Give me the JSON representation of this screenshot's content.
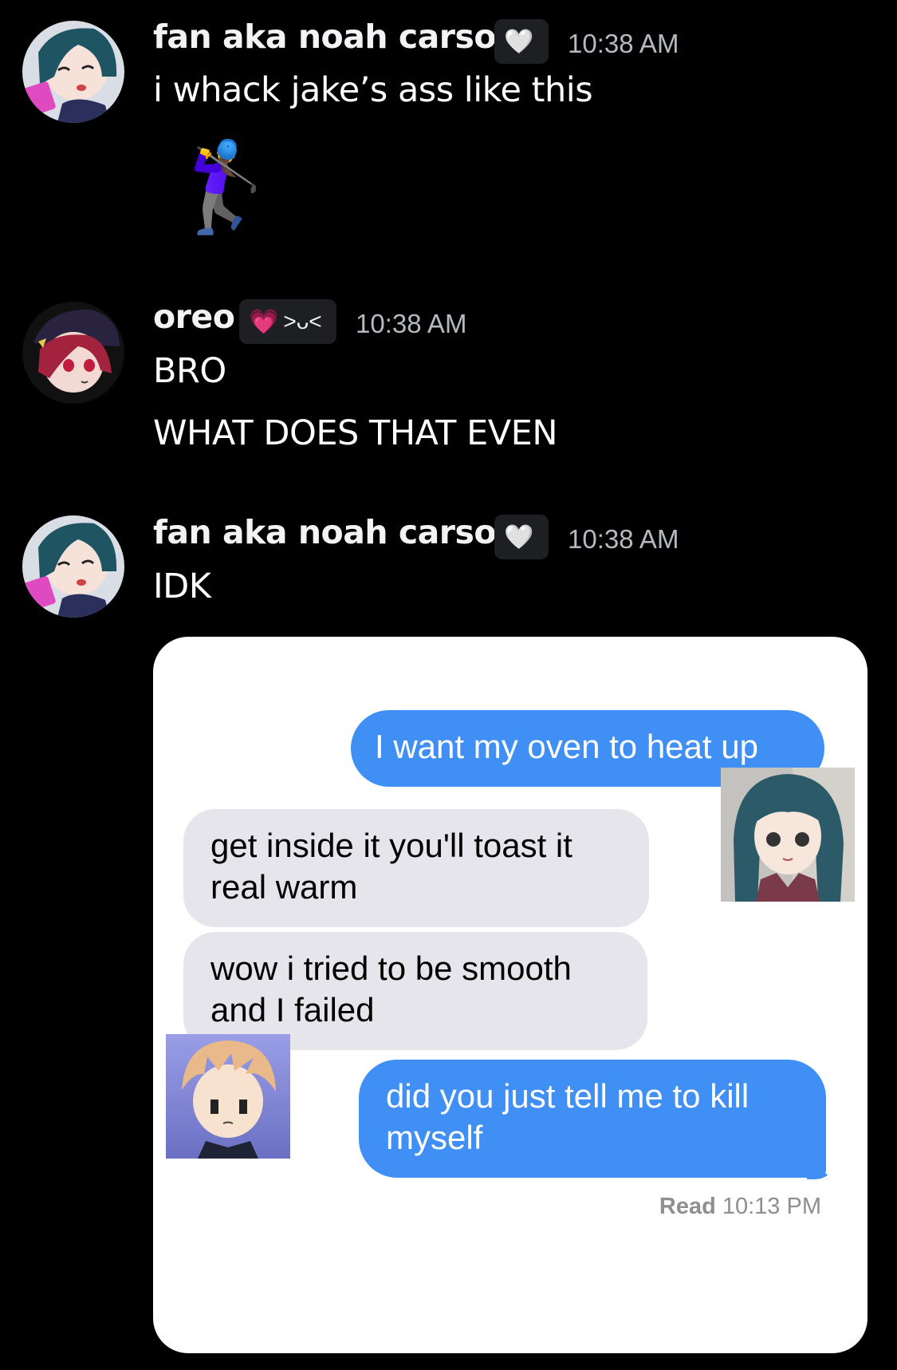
{
  "messages": [
    {
      "author": "fan aka noah carson",
      "tag_emoji": "🤍",
      "time": "10:38 AM",
      "lines": [
        "i whack jake’s ass like this"
      ],
      "emoji": "🏌️‍♀️"
    },
    {
      "author": "oreo",
      "tag_emoji": "💗",
      "tag_text": ">ᴗ<",
      "time": "10:38 AM",
      "lines": [
        "BRO",
        "WHAT DOES THAT EVEN"
      ]
    },
    {
      "author": "fan aka noah carson",
      "tag_emoji": "🤍",
      "time": "10:38 AM",
      "lines": [
        "IDK"
      ]
    }
  ],
  "attachment": {
    "bubbles": [
      {
        "side": "sent",
        "text": "I want my oven to heat up"
      },
      {
        "side": "received",
        "text": "get inside it you'll toast it real warm"
      },
      {
        "side": "received",
        "text": "wow i tried to be smooth and I failed"
      },
      {
        "side": "sent",
        "text": "did you just tell me to kill myself"
      }
    ],
    "read_label": "Read",
    "read_time": "10:13 PM"
  },
  "colors": {
    "background": "#000000",
    "sent_bubble": "#3f8ff5",
    "received_bubble": "#e6e5eb",
    "timestamp": "#b5bac1"
  }
}
